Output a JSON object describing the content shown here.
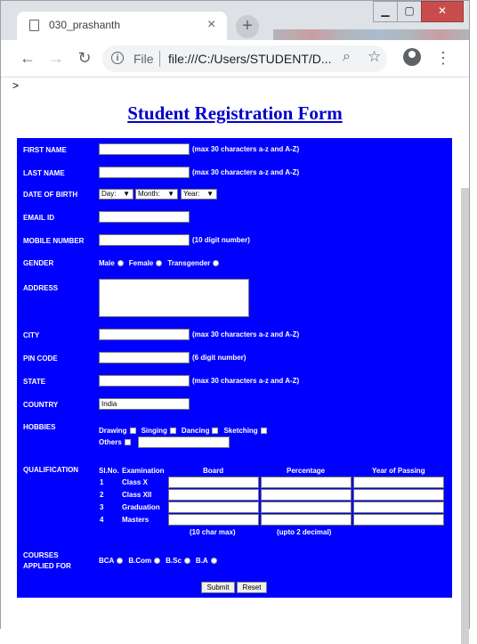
{
  "browser": {
    "tab_title": "030_prashanth",
    "tab_close": "×",
    "new_tab": "+",
    "scheme": "File",
    "url": "file:///C:/Users/STUDENT/D...",
    "window_min": "▁",
    "window_max": "▢",
    "window_close": "✕"
  },
  "page": {
    "stray_text": ">",
    "heading": "Student Registration Form"
  },
  "form": {
    "first_name": {
      "label": "FIRST NAME",
      "value": "",
      "hint": "(max 30 characters a-z and A-Z)"
    },
    "last_name": {
      "label": "LAST NAME",
      "value": "",
      "hint": "(max 30 characters a-z and A-Z)"
    },
    "dob": {
      "label": "DATE OF BIRTH",
      "day": "Day:",
      "month": "Month:",
      "year": "Year:"
    },
    "email": {
      "label": "EMAIL ID",
      "value": ""
    },
    "mobile": {
      "label": "MOBILE NUMBER",
      "value": "",
      "hint": "(10 digit number)"
    },
    "gender": {
      "label": "GENDER",
      "options": [
        "Male",
        "Female",
        "Transgender"
      ]
    },
    "address": {
      "label": "ADDRESS"
    },
    "city": {
      "label": "CITY",
      "value": "",
      "hint": "(max 30 characters a-z and A-Z)"
    },
    "pin": {
      "label": "PIN CODE",
      "value": "",
      "hint": "(6 digit number)"
    },
    "state": {
      "label": "STATE",
      "value": "",
      "hint": "(max 30 characters a-z and A-Z)"
    },
    "country": {
      "label": "COUNTRY",
      "value": "India"
    },
    "hobbies": {
      "label": "HOBBIES",
      "options": [
        "Drawing",
        "Singing",
        "Dancing",
        "Sketching"
      ],
      "others": "Others"
    },
    "qualification": {
      "label": "QUALIFICATION",
      "headers": [
        "Sl.No.",
        "Examination",
        "Board",
        "Percentage",
        "Year of Passing"
      ],
      "rows": [
        {
          "sl": "1",
          "exam": "Class X"
        },
        {
          "sl": "2",
          "exam": "Class XII"
        },
        {
          "sl": "3",
          "exam": "Graduation"
        },
        {
          "sl": "4",
          "exam": "Masters"
        }
      ],
      "note_board": "(10 char max)",
      "note_percentage": "(upto 2 decimal)"
    },
    "courses": {
      "label_line1": "COURSES",
      "label_line2": "APPLIED FOR",
      "options": [
        "BCA",
        "B.Com",
        "B.Sc",
        "B.A"
      ]
    },
    "submit": "Submit",
    "reset": "Reset"
  },
  "colors": {
    "form_bg": "#0000ff",
    "heading": "#0000cc"
  }
}
